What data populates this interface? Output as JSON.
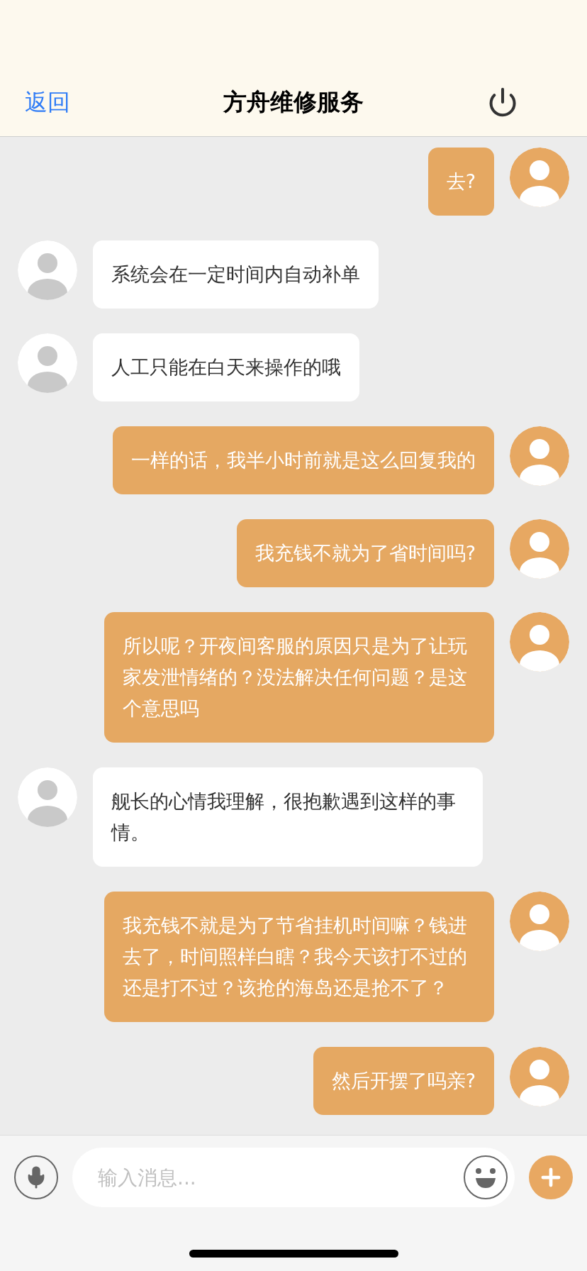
{
  "header": {
    "back": "返回",
    "title": "方舟维修服务"
  },
  "messages": [
    {
      "kind": "sent",
      "text": "去?"
    },
    {
      "kind": "received",
      "text": "系统会在一定时间内自动补单"
    },
    {
      "kind": "received",
      "text": "人工只能在白天来操作的哦"
    },
    {
      "kind": "sent",
      "text": "一样的话，我半小时前就是这么回复我的"
    },
    {
      "kind": "sent",
      "text": "我充钱不就为了省时间吗?"
    },
    {
      "kind": "sent",
      "text": "所以呢？开夜间客服的原因只是为了让玩家发泄情绪的？没法解决任何问题？是这个意思吗"
    },
    {
      "kind": "received",
      "text": "舰长的心情我理解，很抱歉遇到这样的事情。"
    },
    {
      "kind": "sent",
      "text": "我充钱不就是为了节省挂机时间嘛？钱进去了，时间照样白瞎？我今天该打不过的还是打不过？该抢的海岛还是抢不了？"
    },
    {
      "kind": "sent",
      "text": "然后开摆了吗亲?"
    }
  ],
  "composer": {
    "placeholder": "输入消息..."
  }
}
